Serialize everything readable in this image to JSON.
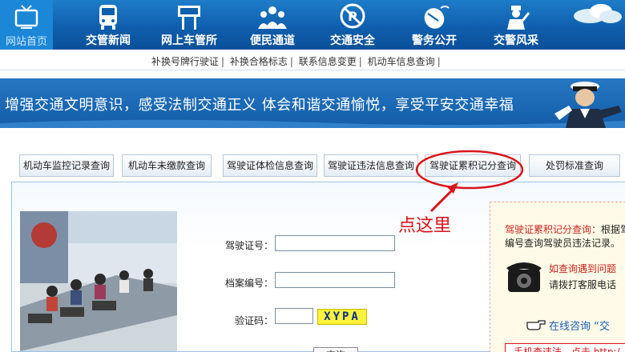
{
  "nav": {
    "home": "网站首页",
    "items": [
      {
        "label": "交管新闻",
        "icon": "bus-icon"
      },
      {
        "label": "网上车管所",
        "icon": "sign-board-icon"
      },
      {
        "label": "便民通道",
        "icon": "people-icon"
      },
      {
        "label": "交通安全",
        "icon": "no-parking-icon"
      },
      {
        "label": "警务公开",
        "icon": "mouse-icon"
      },
      {
        "label": "交警风采",
        "icon": "traffic-police-icon"
      }
    ]
  },
  "subnav": {
    "links": [
      "补换号牌行驶证",
      "补换合格标志",
      "联系信息变更",
      "机动车信息查询"
    ]
  },
  "banner": {
    "slogan": "增强交通文明意识，感受法制交通正义   体会和谐交通愉悦，享受平安交通幸福"
  },
  "tabs": [
    "机动车监控记录查询",
    "机动车未缴款查询",
    "驾驶证体检信息查询",
    "驾驶证违法信息查询",
    "驾驶证累积记分查询",
    "处罚标准查询"
  ],
  "form": {
    "license_label": "驾驶证号：",
    "license_value": "",
    "file_label": "档案编号：",
    "file_value": "",
    "captcha_label": "验证码：",
    "captcha_value": "",
    "captcha_text": "XYPA",
    "submit": "查询"
  },
  "annotation": {
    "text": "点这里"
  },
  "info": {
    "title": "驾驶证累积记分查询：",
    "desc_tail": "根据驾",
    "desc2": "编号查询驾驶员违法记录。",
    "help1": "如查询遇到问题",
    "help2": "请拨打客服电话",
    "consult": "在线咨询 “交",
    "mobile": "手机查违法，点击 http:/"
  },
  "colors": {
    "nav_blue": "#0f5fae",
    "annotation_red": "#d8151a",
    "info_title_red": "#c7241c"
  }
}
